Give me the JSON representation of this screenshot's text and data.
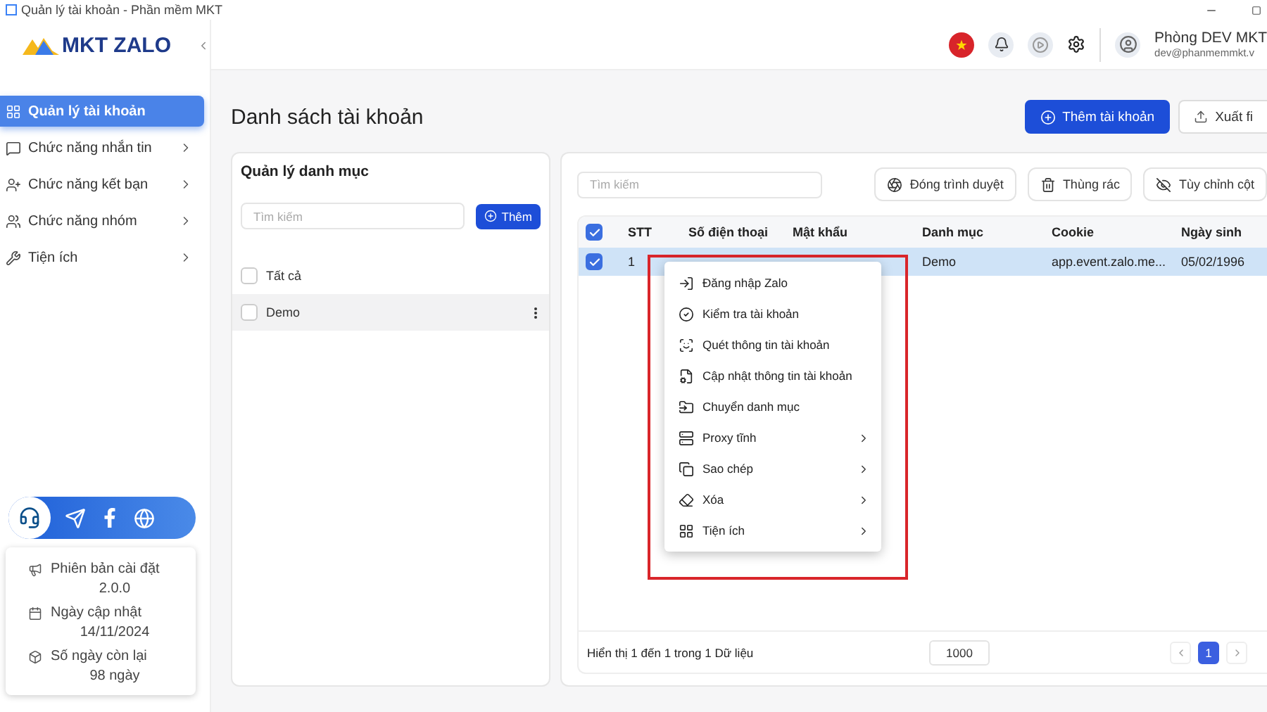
{
  "window": {
    "title": "Quản lý tài khoản - Phần mềm MKT"
  },
  "logo": {
    "text": "MKT ZALO"
  },
  "sidebar": {
    "items": [
      {
        "label": "Quản lý tài khoản",
        "selected": true,
        "has_submenu": false
      },
      {
        "label": "Chức năng nhắn tin",
        "selected": false,
        "has_submenu": true
      },
      {
        "label": "Chức năng kết bạn",
        "selected": false,
        "has_submenu": true
      },
      {
        "label": "Chức năng nhóm",
        "selected": false,
        "has_submenu": true
      },
      {
        "label": "Tiện ích",
        "selected": false,
        "has_submenu": true
      }
    ]
  },
  "version_card": {
    "items": [
      {
        "label": "Phiên bản cài đặt",
        "value": "2.0.0"
      },
      {
        "label": "Ngày cập nhật",
        "value": "14/11/2024"
      },
      {
        "label": "Số ngày còn lại",
        "value": "98 ngày"
      }
    ]
  },
  "user": {
    "name": "Phòng DEV MKT",
    "email": "dev@phanmemmkt.v"
  },
  "page_title": "Danh sách tài khoản",
  "header_buttons": [
    {
      "label": "Thêm tài khoản",
      "kind": "primary"
    },
    {
      "label": "Xuất fi",
      "kind": "secondary"
    }
  ],
  "category_panel": {
    "title": "Quản lý danh mục",
    "search": {
      "placeholder": "Tìm kiếm"
    },
    "add_button": "Thêm",
    "items": [
      {
        "label": "Tất cả",
        "checked": false,
        "selected": false
      },
      {
        "label": "Demo",
        "checked": false,
        "selected": true
      }
    ]
  },
  "accounts": {
    "search": {
      "placeholder": "Tìm kiếm"
    },
    "toolbar": [
      "Đóng trình duyệt",
      "Thùng rác",
      "Tùy chỉnh cột"
    ],
    "header_checked": true,
    "columns": [
      "STT",
      "Số điện thoại",
      "Mật khẩu",
      "Danh mục",
      "Cookie",
      "Ngày sinh"
    ],
    "rows": [
      {
        "checked": true,
        "selected": true,
        "cells": [
          "1",
          null,
          null,
          "Demo",
          "app.event.zalo.me...",
          "05/02/1996"
        ]
      }
    ],
    "footer": "Hiển thị 1 đến 1 trong 1 Dữ liệu",
    "page_size": "1000",
    "pages": [
      {
        "label": "1",
        "selected": true
      }
    ]
  },
  "context_menu": {
    "items": [
      {
        "label": "Đăng nhập Zalo",
        "has_submenu": false
      },
      {
        "label": "Kiểm tra tài khoản",
        "has_submenu": false
      },
      {
        "label": "Quét thông tin tài khoản",
        "has_submenu": false
      },
      {
        "label": "Cập nhật thông tin tài khoản",
        "has_submenu": false
      },
      {
        "label": "Chuyển danh mục",
        "has_submenu": false
      },
      {
        "label": "Proxy tĩnh",
        "has_submenu": true
      },
      {
        "label": "Sao chép",
        "has_submenu": true
      },
      {
        "label": "Xóa",
        "has_submenu": true
      },
      {
        "label": "Tiện ích",
        "has_submenu": true
      }
    ]
  }
}
